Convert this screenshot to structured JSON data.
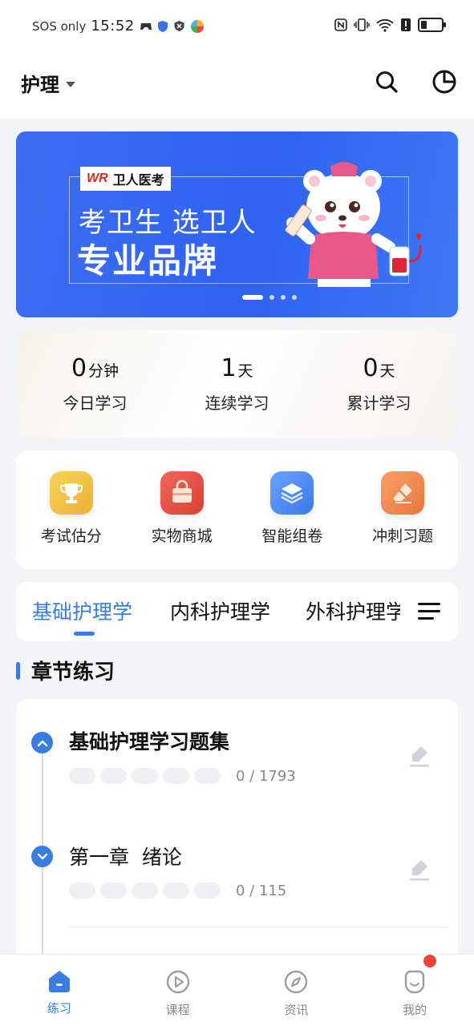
{
  "status_bar": {
    "sos": "SOS only",
    "time": "15:52"
  },
  "header": {
    "subject": "护理"
  },
  "banner": {
    "brand": "卫人医考",
    "brand_mark": "WR",
    "slogan_line1": "考卫生 选卫人",
    "slogan_line2": "专业品牌",
    "slide_count": 4,
    "active_slide": 0
  },
  "stats": [
    {
      "value": "0",
      "unit": "分钟",
      "label": "今日学习"
    },
    {
      "value": "1",
      "unit": "天",
      "label": "连续学习"
    },
    {
      "value": "0",
      "unit": "天",
      "label": "累计学习"
    }
  ],
  "quick_entries": [
    {
      "label": "考试估分",
      "icon": "trophy-icon",
      "color": "#f2bf3f"
    },
    {
      "label": "实物商城",
      "icon": "shopping-bag-icon",
      "color": "#e9534a"
    },
    {
      "label": "智能组卷",
      "icon": "layers-icon",
      "color": "#4f8df5"
    },
    {
      "label": "冲刺习题",
      "icon": "eraser-icon",
      "color": "#f08a4b"
    }
  ],
  "subject_tabs": [
    {
      "label": "基础护理学",
      "active": true
    },
    {
      "label": "内科护理学",
      "active": false
    },
    {
      "label": "外科护理学",
      "active": false
    }
  ],
  "section": {
    "title": "章节练习"
  },
  "chapters": [
    {
      "title": "基础护理学习题集",
      "progress": "0 / 1793",
      "expanded": true
    },
    {
      "title": "第一章  绪论",
      "progress": "0 / 115",
      "expanded": false
    }
  ],
  "bottom_nav": [
    {
      "label": "练习",
      "icon": "home-icon",
      "active": true
    },
    {
      "label": "课程",
      "icon": "play-circle-icon",
      "active": false
    },
    {
      "label": "资讯",
      "icon": "compass-icon",
      "active": false
    },
    {
      "label": "我的",
      "icon": "smiley-icon",
      "active": false,
      "badge": true
    }
  ],
  "colors": {
    "accent": "#3a7de0",
    "banner": "#3068f0",
    "badge": "#e8463a"
  }
}
